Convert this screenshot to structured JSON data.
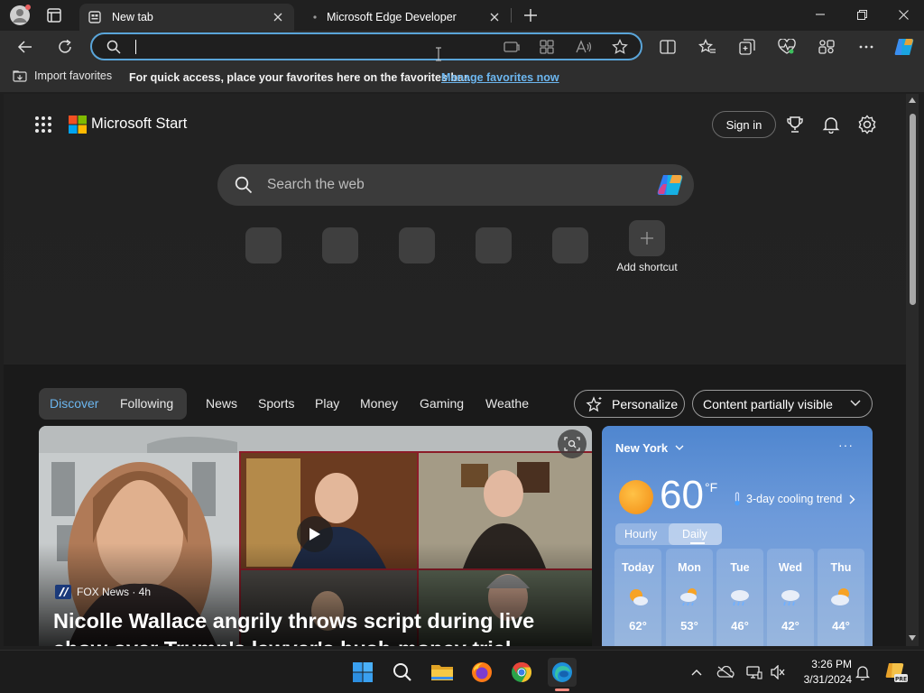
{
  "browser": {
    "tabs": [
      {
        "title": "New tab",
        "active": true
      },
      {
        "title": "Microsoft Edge Developer",
        "active": false
      }
    ],
    "address": {
      "value": "",
      "placeholder": ""
    },
    "favorites_bar": {
      "import_label": "Import favorites",
      "hint": "For quick access, place your favorites here on the favorites bar.",
      "manage_link": "Manage favorites now"
    }
  },
  "start_page": {
    "brand": "Microsoft Start",
    "sign_in": "Sign in",
    "search_placeholder": "Search the web",
    "add_shortcut": "Add shortcut",
    "feed_tabs": {
      "discover": "Discover",
      "following": "Following",
      "items": [
        "News",
        "Sports",
        "Play",
        "Money",
        "Gaming",
        "Weathe"
      ]
    },
    "personalize": "Personalize",
    "content_visibility": "Content partially visible",
    "news_card": {
      "source": "FOX News · 4h",
      "headline_line1": "Nicolle Wallace angrily throws script during live",
      "headline_line2": "show over Trump's lawyer's hush-money trial"
    },
    "weather": {
      "location": "New York",
      "more": "···",
      "temperature": "60",
      "unit": "°F",
      "trend": "3-day cooling trend",
      "tab_hourly": "Hourly",
      "tab_daily": "Daily",
      "days": [
        {
          "day": "Today",
          "temp": "62°",
          "icon": "partly-sunny-icon"
        },
        {
          "day": "Mon",
          "temp": "53°",
          "icon": "rain-sun-icon"
        },
        {
          "day": "Tue",
          "temp": "46°",
          "icon": "rain-icon"
        },
        {
          "day": "Wed",
          "temp": "42°",
          "icon": "rain-icon"
        },
        {
          "day": "Thu",
          "temp": "44°",
          "icon": "partly-cloudy-icon"
        }
      ]
    }
  },
  "taskbar": {
    "time": "3:26 PM",
    "date": "3/31/2024",
    "apps": [
      "start-icon",
      "search-icon",
      "file-explorer-icon",
      "firefox-icon",
      "chrome-icon",
      "edge-icon"
    ]
  },
  "colors": {
    "accent": "#6cb6ef",
    "address_border": "#5aa5d9",
    "video_border": "#8c1c28"
  }
}
